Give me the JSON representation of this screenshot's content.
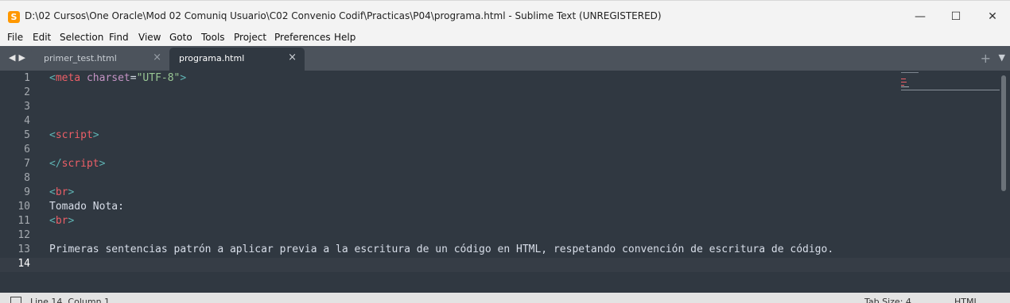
{
  "window": {
    "title": "D:\\02 Cursos\\One Oracle\\Mod 02 Comuniq Usuario\\C02 Convenio Codif\\Practicas\\P04\\programa.html - Sublime Text (UNREGISTERED)",
    "app_icon_letter": "S",
    "minimize_glyph": "—",
    "maximize_glyph": "☐",
    "close_glyph": "✕"
  },
  "menu": [
    "File",
    "Edit",
    "Selection",
    "Find",
    "View",
    "Goto",
    "Tools",
    "Project",
    "Preferences",
    "Help"
  ],
  "tabs": [
    {
      "label": "primer_test.html",
      "close": "×",
      "active": false
    },
    {
      "label": "programa.html",
      "close": "×",
      "active": true
    }
  ],
  "tabbar": {
    "nav": "◀▶",
    "plus": "+",
    "menu": "▼"
  },
  "editor": {
    "current_line": 14,
    "line_numbers": [
      "1",
      "2",
      "3",
      "4",
      "5",
      "6",
      "7",
      "8",
      "9",
      "10",
      "11",
      "12",
      "13",
      "14"
    ],
    "lines": {
      "l1": {
        "open": "<",
        "tag": "meta",
        "attr": "charset",
        "eq": "=",
        "value": "\"UTF-8\"",
        "close": ">"
      },
      "l5": {
        "open": "<",
        "tag": "script",
        "close": ">"
      },
      "l7": {
        "open": "</",
        "tag": "script",
        "close": ">"
      },
      "l9": {
        "open": "<",
        "tag": "br",
        "close": ">"
      },
      "l10": "Tomado Nota:",
      "l11": {
        "open": "<",
        "tag": "br",
        "close": ">"
      },
      "l13": "Primeras sentencias patrón a aplicar previa a la escritura de un código en HTML, respetando convención de escritura de código."
    }
  },
  "statusbar": {
    "position": "Line 14, Column 1",
    "tab_size": "Tab Size: 4",
    "syntax": "HTML"
  },
  "colors": {
    "editor_bg": "#303841",
    "tag": "#ec5f67",
    "attr": "#c594c5",
    "string": "#99c794",
    "punctuation": "#5fb3b3"
  }
}
